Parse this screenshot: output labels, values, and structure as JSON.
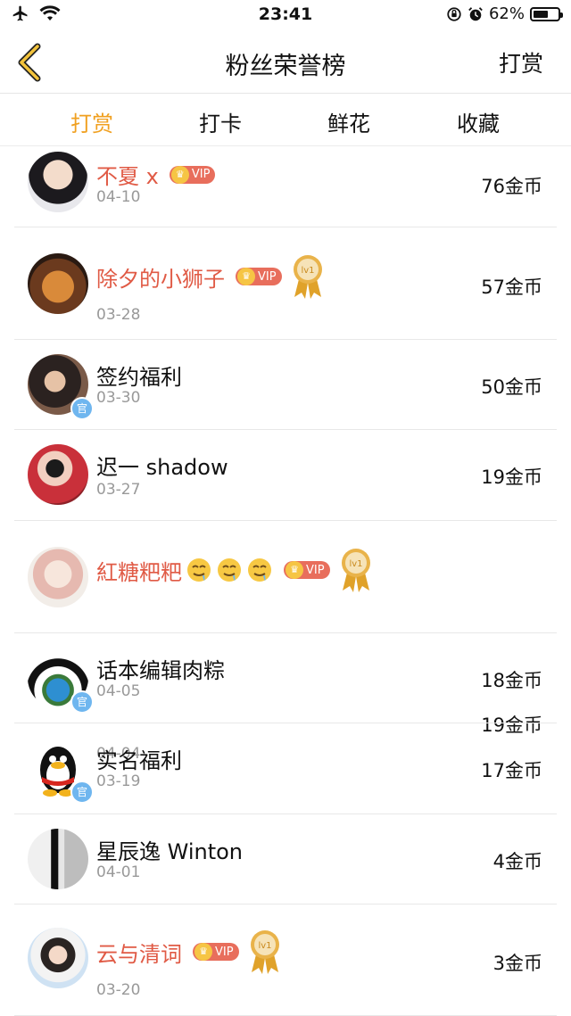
{
  "status": {
    "time": "23:41",
    "battery": "62%",
    "battery_level": 0.62
  },
  "nav": {
    "title": "粉丝荣誉榜",
    "action": "打赏"
  },
  "tabs": [
    {
      "label": "打赏",
      "active": true
    },
    {
      "label": "打卡",
      "active": false
    },
    {
      "label": "鲜花",
      "active": false
    },
    {
      "label": "收藏",
      "active": false
    }
  ],
  "vip_label": "VIP",
  "medal_label": "lv1",
  "official_label": "官",
  "emoji": "🤤",
  "rows": [
    {
      "name": "不夏 x",
      "date": "04-10",
      "coins": "76金币"
    },
    {
      "name": "除夕的小狮子",
      "date": "03-28",
      "coins": "57金币"
    },
    {
      "name": "签约福利",
      "date": "03-30",
      "coins": "50金币"
    },
    {
      "name": "迟一 shadow",
      "date": "03-27",
      "coins": "19金币"
    },
    {
      "name": "紅糖粑粑",
      "date": "04-04",
      "coins": "19金币"
    },
    {
      "name": "话本编辑肉粽",
      "date": "04-05",
      "coins": "18金币"
    },
    {
      "name": "实名福利",
      "date": "03-19",
      "coins": "17金币"
    },
    {
      "name": "星辰逸 Winton",
      "date": "04-01",
      "coins": "4金币"
    },
    {
      "name": "云与清词",
      "date": "03-20",
      "coins": "3金币"
    }
  ]
}
